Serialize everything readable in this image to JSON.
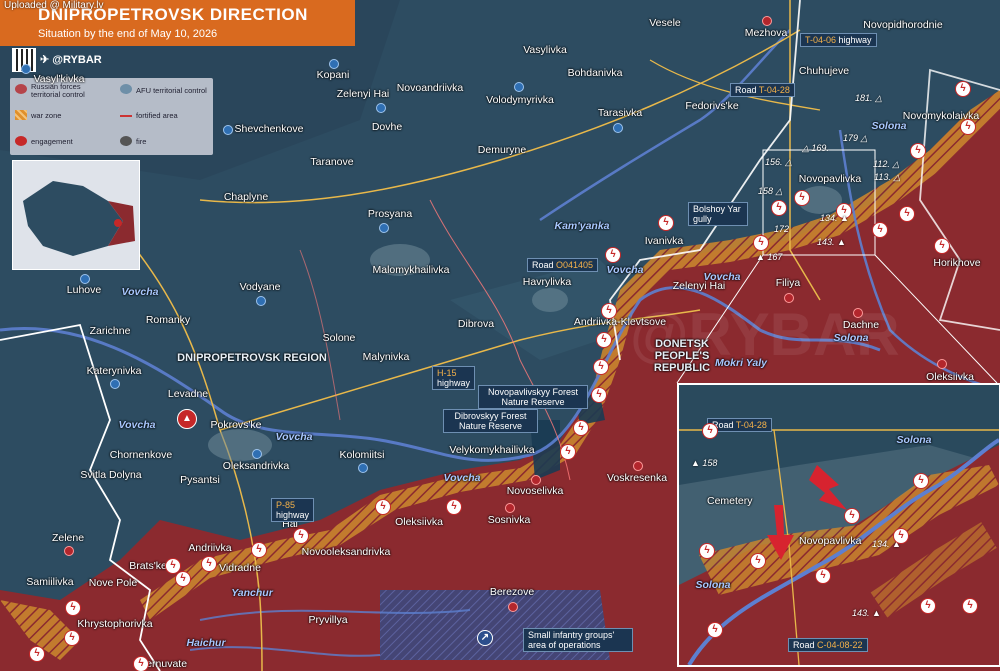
{
  "upload_note": "Uploaded @ Military.lv",
  "title": "DNIPROPETROVSK DIRECTION",
  "subtitle": "Situation by the end of May 10, 2026",
  "channel": "@RYBAR",
  "legend": {
    "russian": "Russian forces territorial control",
    "afu": "AFU territorial control",
    "war_zone": "war zone",
    "fortified": "fortified area",
    "engagement": "engagement",
    "fire": "fire"
  },
  "colors": {
    "russian": "#8b2a2f",
    "afu": "#2e4c63",
    "war_zone": "#e0902c",
    "accent": "#d96a1f",
    "road": "#e8b84a"
  },
  "regions": {
    "dnipro": "DNIPROPETROVSK REGION",
    "donetsk": "DONETSK PEOPLE'S REPUBLIC"
  },
  "settlements": [
    {
      "name": "Vasyl'kivka"
    },
    {
      "name": "Kopani"
    },
    {
      "name": "Zelenyi Hai"
    },
    {
      "name": "Novoandriivka"
    },
    {
      "name": "Vasylivka"
    },
    {
      "name": "Vesele"
    },
    {
      "name": "Bohdanivka"
    },
    {
      "name": "Mezhova"
    },
    {
      "name": "Novopidhorodnie"
    },
    {
      "name": "Volodymyrivka"
    },
    {
      "name": "Chuhujeve"
    },
    {
      "name": "Shevchenkove"
    },
    {
      "name": "Dovhe"
    },
    {
      "name": "Tarasivka"
    },
    {
      "name": "Fedorivs'ke"
    },
    {
      "name": "Novomykolaivka"
    },
    {
      "name": "Demuryne"
    },
    {
      "name": "Taranove"
    },
    {
      "name": "Chaplyne"
    },
    {
      "name": "Prosyana"
    },
    {
      "name": "Novopavlivka"
    },
    {
      "name": "Ivanivka"
    },
    {
      "name": "Malomykhailivka"
    },
    {
      "name": "Horikhove"
    },
    {
      "name": "Havrylivka"
    },
    {
      "name": "Luhove"
    },
    {
      "name": "Vodyane"
    },
    {
      "name": "Zelenyi Hai"
    },
    {
      "name": "Filiya"
    },
    {
      "name": "Romanky"
    },
    {
      "name": "Zarichne"
    },
    {
      "name": "Solone"
    },
    {
      "name": "Dibrova"
    },
    {
      "name": "Andriivka-Klevtsove"
    },
    {
      "name": "Dachne"
    },
    {
      "name": "Katerynivka"
    },
    {
      "name": "Malynivka"
    },
    {
      "name": "Oleksiivka"
    },
    {
      "name": "Levadne"
    },
    {
      "name": "Pokrovs'ke"
    },
    {
      "name": "Chornenkove"
    },
    {
      "name": "Oleksandrivka"
    },
    {
      "name": "Kolomiitsi"
    },
    {
      "name": "Velykomykhailivka"
    },
    {
      "name": "Voskresenka"
    },
    {
      "name": "Svitla Dolyna"
    },
    {
      "name": "Pysantsi"
    },
    {
      "name": "Novoselivka"
    },
    {
      "name": "Oleksiivka"
    },
    {
      "name": "Sosnivka"
    },
    {
      "name": "Zelene"
    },
    {
      "name": "Hai"
    },
    {
      "name": "Andriivka"
    },
    {
      "name": "Novooleksandrivka"
    },
    {
      "name": "Brats'ke"
    },
    {
      "name": "Vidradne"
    },
    {
      "name": "Samiilivka"
    },
    {
      "name": "Nove Pole"
    },
    {
      "name": "Berezove"
    },
    {
      "name": "Khrystophorivka"
    },
    {
      "name": "Pryvillya"
    },
    {
      "name": "Ternuvate"
    }
  ],
  "rivers": [
    "Vovcha",
    "Vovcha",
    "Vovcha",
    "Vovcha",
    "Vovcha",
    "Kam'yanka",
    "Vovcha",
    "Solona",
    "Mokri Yaly",
    "Solona",
    "Yanchur",
    "Haichur"
  ],
  "roads": [
    {
      "prefix": "Road ",
      "code": "T-04-28"
    },
    {
      "prefix": "",
      "code": "T-04-06",
      "suffix": " highway"
    },
    {
      "prefix": "Road ",
      "code": "O041405"
    },
    {
      "prefix": "",
      "code": "H-15",
      "suffix": " highway"
    },
    {
      "prefix": "",
      "code": "P-85",
      "suffix": " highway"
    }
  ],
  "callouts": {
    "bolshoy": "Bolshoy Yar gully",
    "novopavlivskyy": "Novopavlivskyy Forest Nature Reserve",
    "dibrovskyy": "Dibrovskyy Forest Nature Reserve",
    "infantry": "Small infantry groups' area of operations"
  },
  "heights": [
    "181.",
    "179",
    "169.",
    "156.",
    "158",
    "112.",
    "113.",
    "134.",
    "172",
    "143.",
    "167"
  ],
  "detail": {
    "road1": {
      "prefix": "Road ",
      "code": "T-04-28"
    },
    "road2": {
      "prefix": "Road ",
      "code": "C-04-08-22"
    },
    "cemetery": "Cemetery",
    "town": "Novopavlivka",
    "river1": "Solona",
    "river2": "Solona",
    "heights": [
      "158",
      "134.",
      "143."
    ]
  }
}
